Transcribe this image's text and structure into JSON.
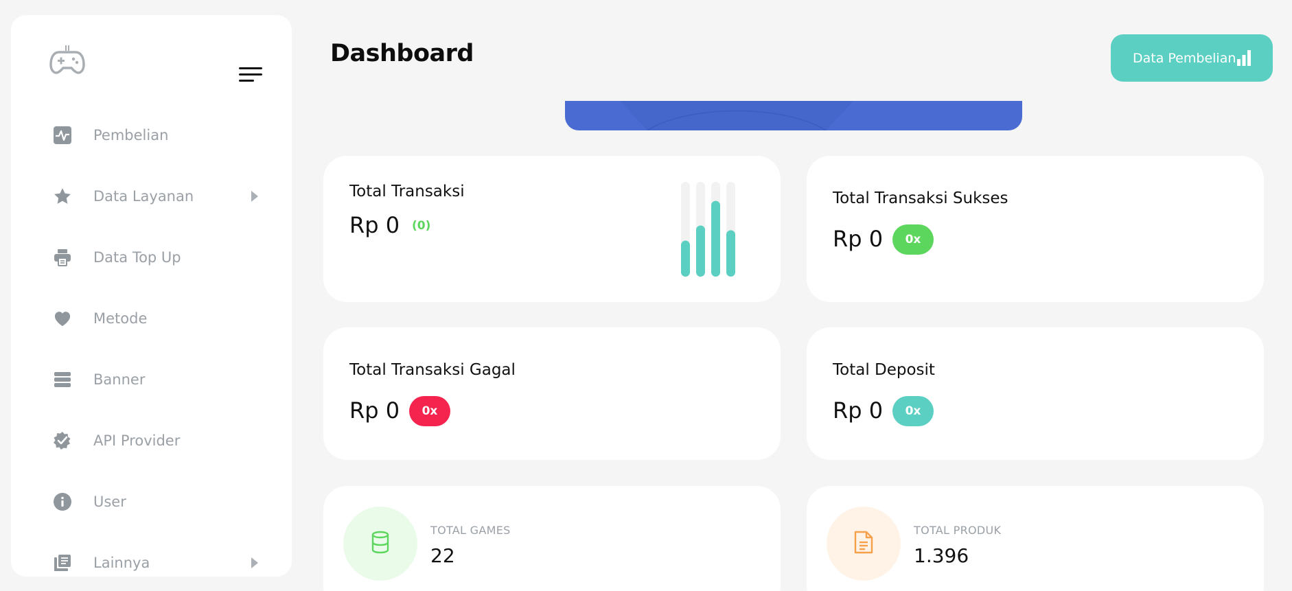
{
  "header": {
    "title": "Dashboard",
    "action_button_label": "Data Pembelian"
  },
  "sidebar": {
    "items": [
      {
        "label": "Pembelian",
        "icon": "activity-icon",
        "has_submenu": false
      },
      {
        "label": "Data Layanan",
        "icon": "star-icon",
        "has_submenu": true
      },
      {
        "label": "Data Top Up",
        "icon": "printer-icon",
        "has_submenu": false
      },
      {
        "label": "Metode",
        "icon": "heart-icon",
        "has_submenu": false
      },
      {
        "label": "Banner",
        "icon": "menu-bars-icon",
        "has_submenu": false
      },
      {
        "label": "API Provider",
        "icon": "badge-check-icon",
        "has_submenu": false
      },
      {
        "label": "User",
        "icon": "info-icon",
        "has_submenu": false
      },
      {
        "label": "Lainnya",
        "icon": "library-icon",
        "has_submenu": true
      }
    ]
  },
  "cards": {
    "total_transaksi": {
      "title": "Total Transaksi",
      "value": "Rp 0",
      "count": "(0)"
    },
    "sukses": {
      "title": "Total Transaksi Sukses",
      "value": "Rp 0",
      "badge": "0x"
    },
    "gagal": {
      "title": "Total Transaksi Gagal",
      "value": "Rp 0",
      "badge": "0x"
    },
    "deposit": {
      "title": "Total Deposit",
      "value": "Rp 0",
      "badge": "0x"
    }
  },
  "stats": {
    "games": {
      "label": "TOTAL GAMES",
      "value": "22",
      "icon": "database-icon"
    },
    "produk": {
      "label": "TOTAL PRODUK",
      "value": "1.396",
      "icon": "file-text-icon"
    }
  },
  "mini_chart": {
    "levels": [
      0.38,
      0.54,
      0.8,
      0.49
    ]
  },
  "colors": {
    "accent": "#5ccfc3",
    "success": "#5cd65c",
    "danger": "#f5244f",
    "blue": "#4a6bd2",
    "icon_gray": "#8f969c"
  }
}
